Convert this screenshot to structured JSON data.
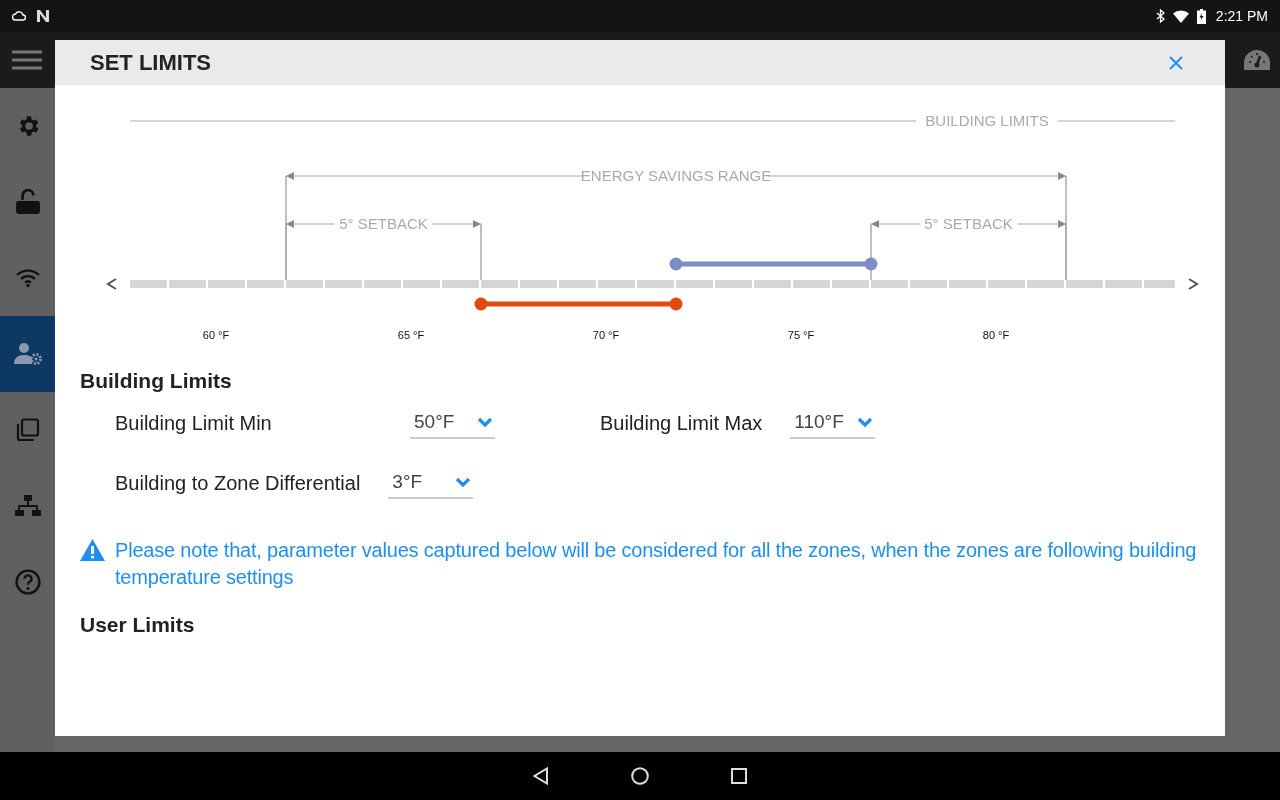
{
  "status_bar": {
    "time": "2:21 PM"
  },
  "sidebar": {
    "items": [
      {
        "kind": "settings",
        "selected": false
      },
      {
        "kind": "unlock",
        "selected": false
      },
      {
        "kind": "wifi",
        "selected": false
      },
      {
        "kind": "user-settings",
        "selected": true
      },
      {
        "kind": "copy",
        "selected": false
      },
      {
        "kind": "network",
        "selected": false
      },
      {
        "kind": "help",
        "selected": false
      }
    ]
  },
  "dialog": {
    "title": "SET LIMITS",
    "range_diagram": {
      "tick_labels": [
        "60 °F",
        "65 °F",
        "70 °F",
        "75 °F",
        "80 °F"
      ],
      "bars": [
        {
          "kind": "upper",
          "color": "#7b8dc9"
        },
        {
          "kind": "lower",
          "color": "#e2490b"
        }
      ],
      "spans": [
        {
          "kind": "limits",
          "text": "BUILDING LIMITS"
        },
        {
          "kind": "range",
          "text": "ENERGY SAVINGS RANGE"
        },
        {
          "kind": "setback-low",
          "text": "5° SETBACK"
        },
        {
          "kind": "setback-high",
          "text": "5° SETBACK"
        }
      ]
    },
    "building_limits": {
      "heading": "Building Limits",
      "rows": [
        [
          {
            "label": "Building Limit Min",
            "value": "50°F"
          },
          {
            "label": "Building Limit Max",
            "value": "110°F"
          }
        ],
        [
          {
            "label": "Building to Zone Differential",
            "value": "3°F"
          }
        ]
      ]
    },
    "notice": "Please note that, parameter values captured below will be considered for all the zones, when the zones are following building temperature settings",
    "user_limits": {
      "heading": "User Limits"
    }
  }
}
